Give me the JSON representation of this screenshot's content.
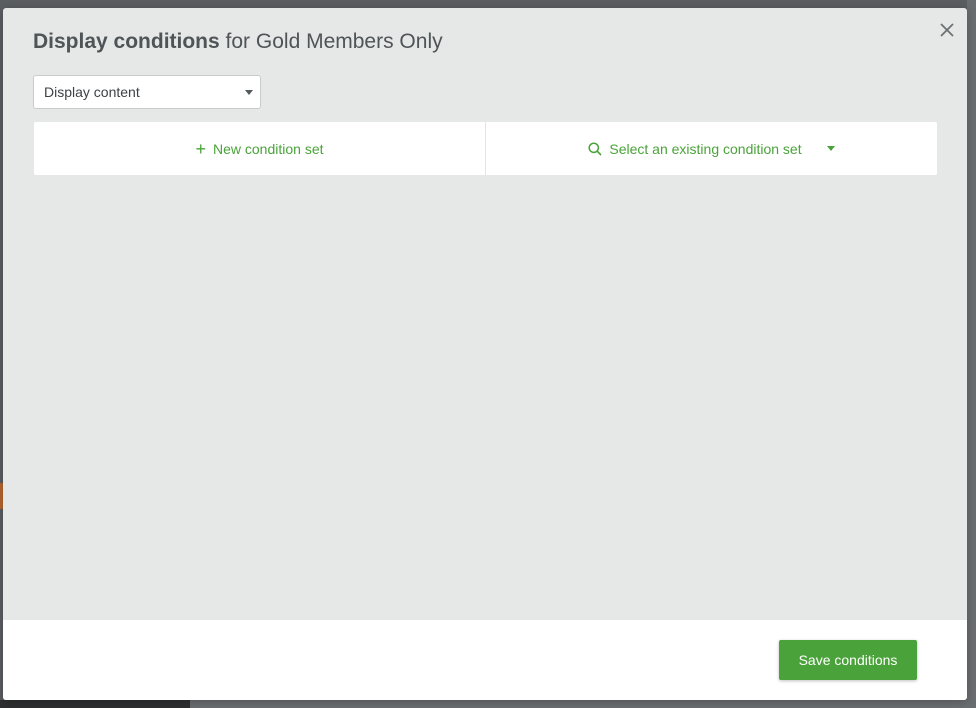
{
  "modal": {
    "title_strong": "Display conditions",
    "title_rest": "for Gold Members Only"
  },
  "select": {
    "value": "Display content"
  },
  "actions": {
    "new_condition": "New condition set",
    "existing_condition": "Select an existing condition set"
  },
  "footer": {
    "save_label": "Save conditions"
  },
  "icons": {
    "close": "close-icon",
    "plus": "plus-icon",
    "search": "search-icon",
    "caret": "chevron-down-icon"
  },
  "colors": {
    "accent": "#4aa33a",
    "modal_bg": "#e6e8e8",
    "title": "#4f5457"
  }
}
